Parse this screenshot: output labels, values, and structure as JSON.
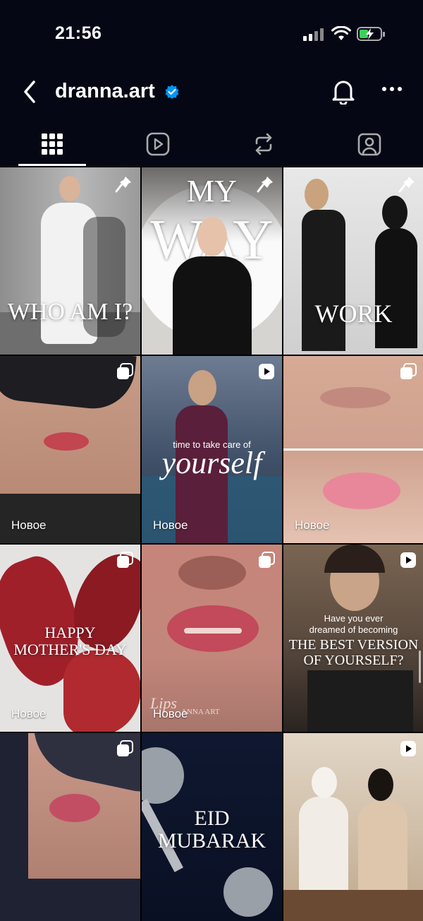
{
  "status": {
    "time": "21:56"
  },
  "header": {
    "username": "dranna.art"
  },
  "tabs": [
    "posts",
    "reels",
    "reposts",
    "tagged"
  ],
  "posts": [
    {
      "overlay": "WHO AM I?",
      "badge": "pin"
    },
    {
      "overlay_top": "MY",
      "overlay_big": "WAY",
      "badge": "pin"
    },
    {
      "overlay": "WORK",
      "badge": "pin"
    },
    {
      "badge": "carousel",
      "new": "Новое"
    },
    {
      "small": "time to take care of",
      "script": "yourself",
      "badge": "reel",
      "new": "Новое"
    },
    {
      "badge": "carousel",
      "new": "Новое"
    },
    {
      "line1": "HAPPY",
      "line2": "MOTHER'S DAY",
      "badge": "carousel",
      "new": "Новое"
    },
    {
      "watermark_script": "Lips",
      "watermark": "ANNA ART",
      "badge": "carousel",
      "new": "Новое"
    },
    {
      "small1": "Have you ever",
      "small2": "dreamed of becoming",
      "big1": "THE BEST VERSION",
      "big2": "OF YOURSELF?",
      "badge": "reel"
    },
    {
      "badge": "carousel"
    },
    {
      "line1": "EID",
      "line2": "MUBARAK"
    },
    {
      "badge": "reel"
    }
  ]
}
